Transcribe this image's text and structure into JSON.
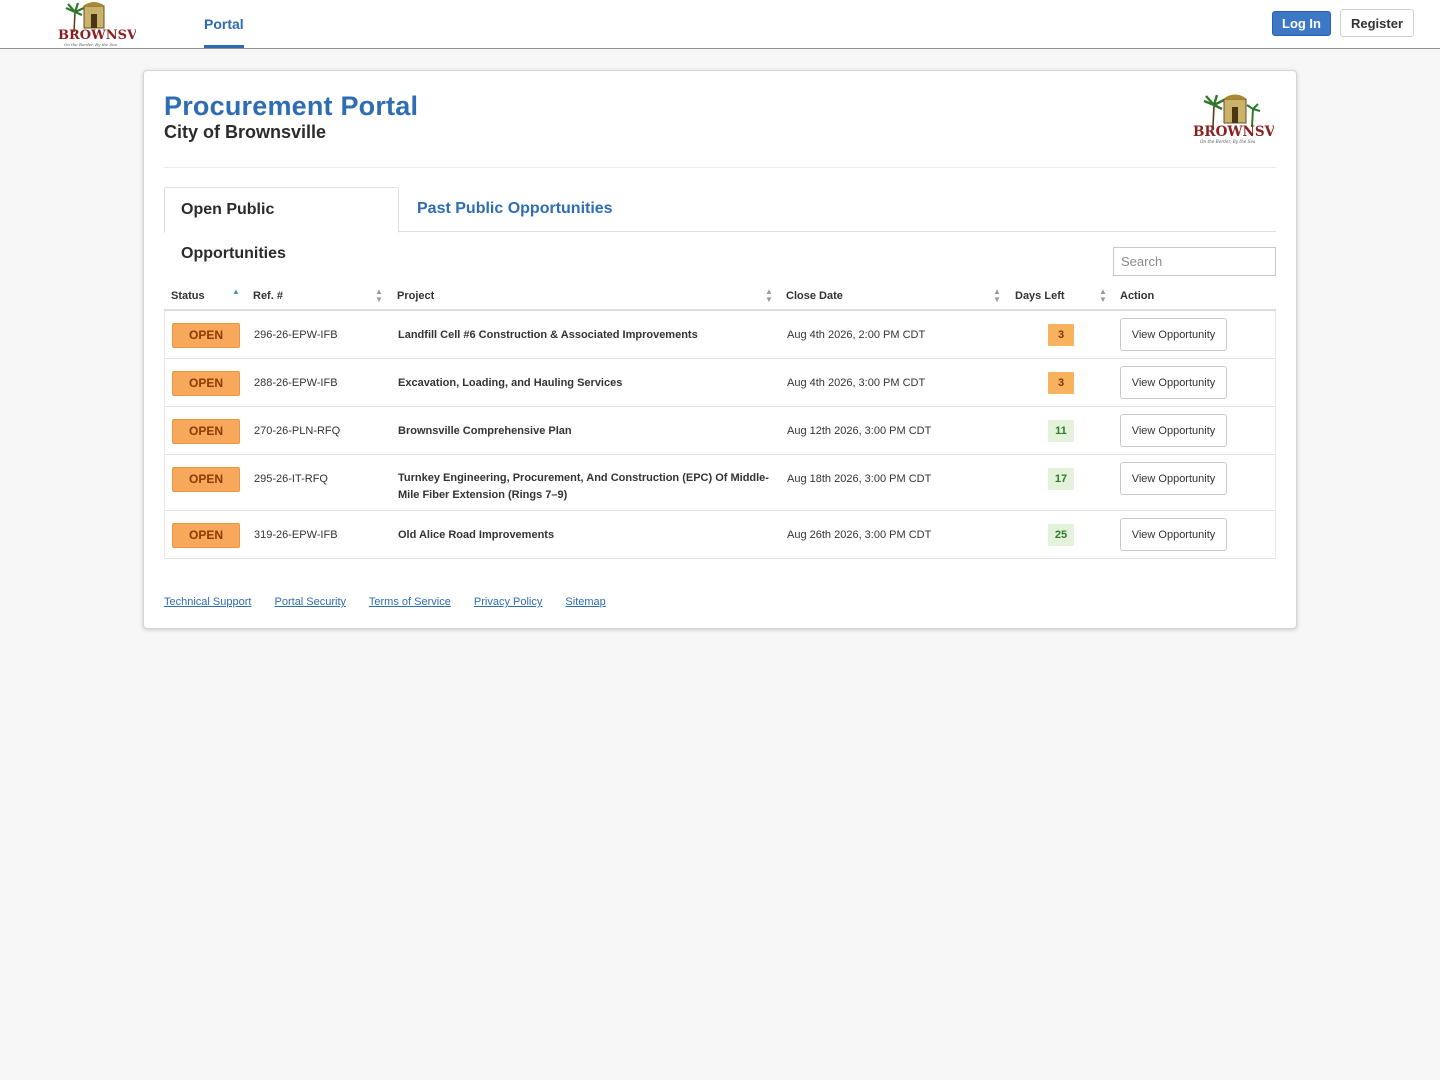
{
  "nav": {
    "portal_label": "Portal",
    "login_label": "Log In",
    "register_label": "Register"
  },
  "logo": {
    "wordmark": "BROWNSVILLE",
    "tagline": "On the Border, By the Sea"
  },
  "header": {
    "title": "Procurement Portal",
    "subtitle": "City of Brownsville"
  },
  "tabs": {
    "open_label": "Open Public Opportunities",
    "past_label": "Past Public Opportunities"
  },
  "search": {
    "placeholder": "Search"
  },
  "table": {
    "columns": {
      "status": "Status",
      "ref": "Ref. #",
      "project": "Project",
      "close_date": "Close Date",
      "days_left": "Days Left",
      "action": "Action"
    },
    "rows": [
      {
        "status": "OPEN",
        "ref": "296-26-EPW-IFB",
        "project": "Landfill Cell #6 Construction & Associated Improvements",
        "close_date": "Aug 4th 2026, 2:00 PM CDT",
        "days_left": "3",
        "action": "View Opportunity"
      },
      {
        "status": "OPEN",
        "ref": "288-26-EPW-IFB",
        "project": "Excavation, Loading, and Hauling Services",
        "close_date": "Aug 4th 2026, 3:00 PM CDT",
        "days_left": "3",
        "action": "View Opportunity"
      },
      {
        "status": "OPEN",
        "ref": "270-26-PLN-RFQ",
        "project": "Brownsville Comprehensive Plan",
        "close_date": "Aug 12th 2026, 3:00 PM CDT",
        "days_left": "11",
        "action": "View Opportunity"
      },
      {
        "status": "OPEN",
        "ref": "295-26-IT-RFQ",
        "project": "Turnkey Engineering, Procurement, And Construction (EPC) Of Middle-Mile Fiber Extension (Rings 7–9)",
        "close_date": "Aug 18th 2026, 3:00 PM CDT",
        "days_left": "17",
        "action": "View Opportunity"
      },
      {
        "status": "OPEN",
        "ref": "319-26-EPW-IFB",
        "project": "Old Alice Road Improvements",
        "close_date": "Aug 26th 2026, 3:00 PM CDT",
        "days_left": "25",
        "action": "View Opportunity"
      }
    ]
  },
  "footer": {
    "links": [
      "Technical Support",
      "Portal Security",
      "Terms of Service",
      "Privacy Policy",
      "Sitemap"
    ]
  },
  "colors": {
    "brand_blue": "#2e6db4",
    "open_orange": "#f7a85b",
    "days_green_bg": "#e4f2dc"
  }
}
